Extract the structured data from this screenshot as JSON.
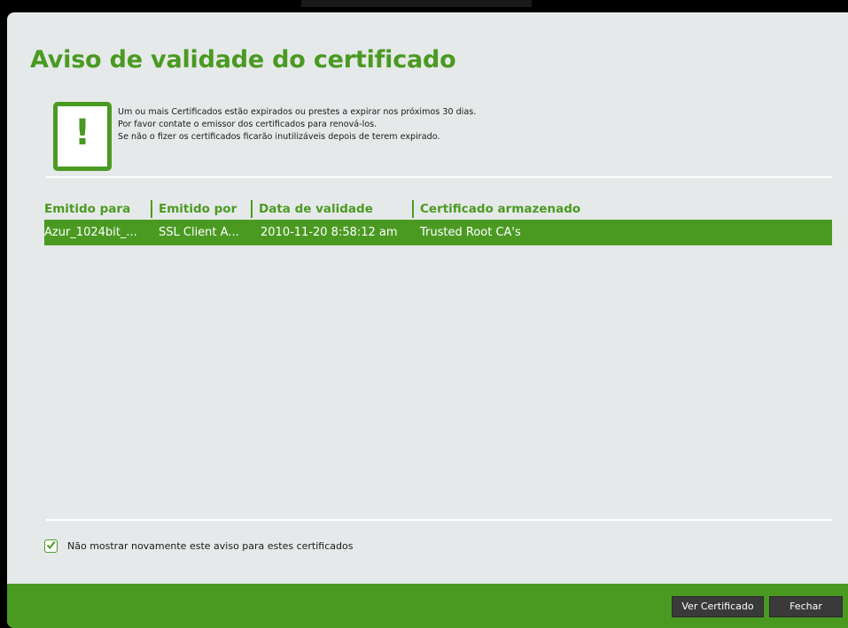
{
  "dialog": {
    "title": "Aviso de validade do certificado",
    "icon": "exclamation-icon",
    "message_lines": [
      "Um ou mais Certificados estão expirados ou prestes a expirar nos próximos 30 dias.",
      "Por favor contate o emissor dos certificados para renová-los.",
      "Se não o fizer os certificados ficarão inutilizáveis depois de terem expirado."
    ]
  },
  "table": {
    "columns": [
      "Emitido para",
      "Emitido por",
      "Data de validade",
      "Certificado armazenado"
    ],
    "rows": [
      {
        "emitido_para": "Azur_1024bit_...",
        "emitido_por": "SSL Client A...",
        "data_validade": "2010-11-20 8:58:12 am",
        "armazenado": "Trusted Root CA's",
        "selected": true
      }
    ]
  },
  "checkbox": {
    "label": "Não mostrar novamente este aviso para estes certificados",
    "checked": true
  },
  "footer": {
    "ver_certificado": "Ver Certificado",
    "fechar": "Fechar"
  },
  "colors": {
    "accent": "#4a9a22",
    "background": "#e6e9e9",
    "button": "#3a3a3a"
  }
}
